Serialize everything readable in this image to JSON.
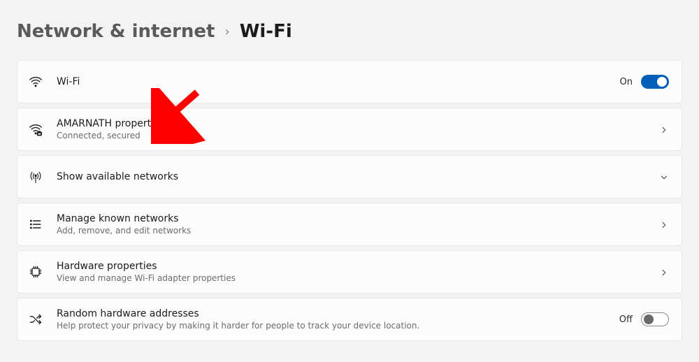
{
  "breadcrumb": {
    "parent": "Network & internet",
    "current": "Wi-Fi"
  },
  "rows": {
    "wifi": {
      "title": "Wi-Fi",
      "state": "On"
    },
    "network": {
      "title": "AMARNATH properties",
      "sub": "Connected, secured"
    },
    "avail": {
      "title": "Show available networks"
    },
    "known": {
      "title": "Manage known networks",
      "sub": "Add, remove, and edit networks"
    },
    "hw": {
      "title": "Hardware properties",
      "sub": "View and manage Wi-Fi adapter properties"
    },
    "rand": {
      "title": "Random hardware addresses",
      "sub": "Help protect your privacy by making it harder for people to track your device location.",
      "state": "Off"
    }
  }
}
